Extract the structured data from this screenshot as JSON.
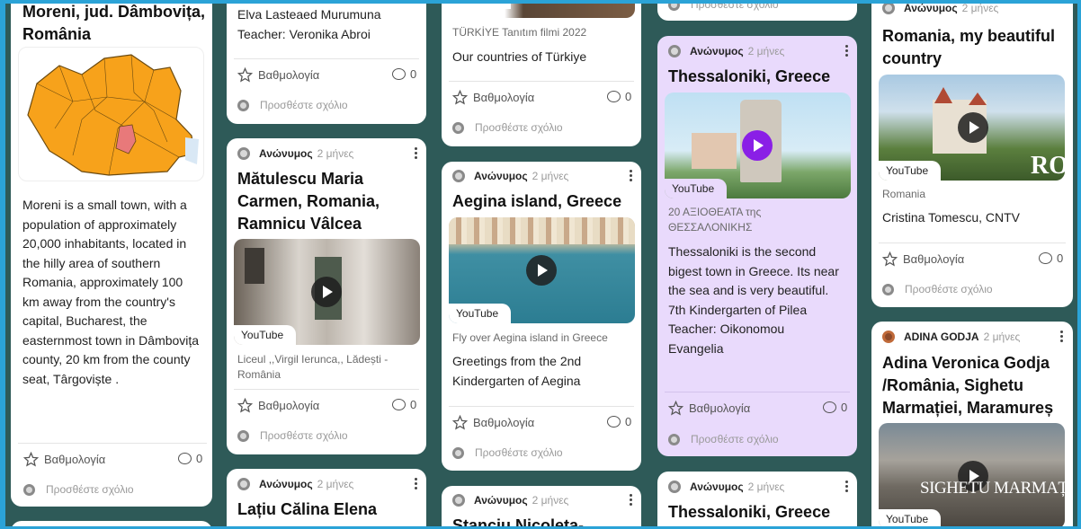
{
  "ui": {
    "rating_label": "Βαθμολογία",
    "comment_count": "0",
    "add_comment_placeholder": "Προσθέστε σχόλιο",
    "youtube_label": "YouTube",
    "anon": "Ανώνυμος",
    "time_ago": "2 μήνες"
  },
  "col1": {
    "title": "Moreni, jud. Dâmbovița, România",
    "body": "Moreni is a small town, with a population of approximately 20,000 inhabitants, located in the hilly area of southern Romania, approximately 100 km away from the country's capital, Bucharest, the easternmost town in Dâmbovița county, 20 km from the county seat, Târgoviște ."
  },
  "col2": {
    "top_lines": [
      "Elva Lasteaed Murumuna",
      "Teacher: Veronika Abroi"
    ],
    "card2_title": "Mătulescu Maria Carmen, Romania, Ramnicu Vâlcea",
    "card2_caption": "Liceul ,,Virgil Ierunca,, Lădești - România",
    "card3_title": "Lațiu Călina Elena"
  },
  "col3": {
    "top_caption": "TÜRKİYE Tanıtım filmi 2022",
    "top_body": "Our countries of Türkiye",
    "card2_title": "Aegina island, Greece",
    "card2_caption": "Fly over Aegina island in Greece",
    "card2_body": "Greetings from the 2nd Kindergarten of Aegina",
    "card3_title": "Stanciu Nicoleta-"
  },
  "col4": {
    "top_text": "Προσθέστε σχόλιο",
    "card2_title": "Thessaloniki, Greece",
    "card2_caption": "20 ΑΞΙΟΘΕΑΤΑ της ΘΕΣΣΑΛΟΝΙΚΗΣ",
    "card2_body": "Thessaloniki is the second bigest town in Greece. Its near the sea and is very beautiful. 7th Kindergarten of Pilea Teacher: Oikonomou Evangelia",
    "card3_title": "Thessaloniki, Greece"
  },
  "col5": {
    "card1_title": "Romania, my beautiful country",
    "card1_caption": "Romania",
    "card1_body": "Cristina Tomescu, CNTV",
    "card1_overlay": "RO",
    "card2_author": "ADINA GODJA",
    "card2_title": "Adina Veronica Godja /România, Sighetu Marmației, Maramureș",
    "card2_overlay": "SIGHETU MARMAȚIE"
  }
}
